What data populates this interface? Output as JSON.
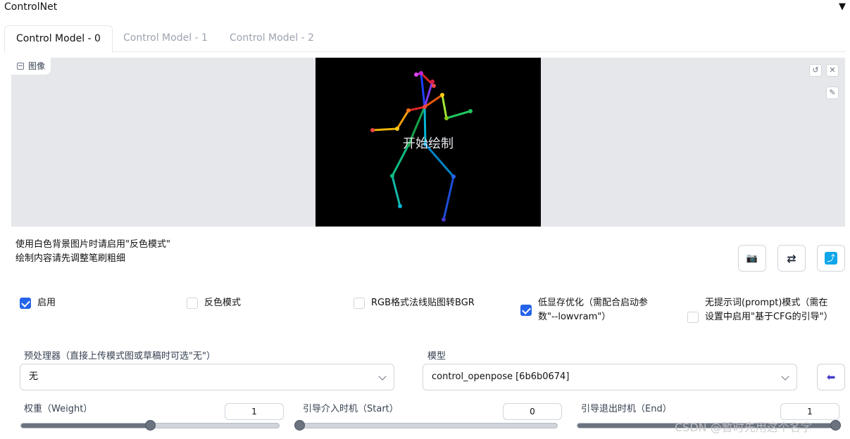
{
  "header": {
    "title": "ControlNet",
    "toggle_icon": "▼"
  },
  "tabs": [
    "Control Model - 0",
    "Control Model - 1",
    "Control Model - 2"
  ],
  "image_panel": {
    "label": "图像",
    "canvas_text": "开始绘制",
    "reset_icon": "↺",
    "close_icon": "✕",
    "brush_icon": "✎"
  },
  "hint": {
    "line1": "使用白色背景图片时请启用\"反色模式\"",
    "line2": "绘制内容请先调整笔刷粗细"
  },
  "actions": {
    "camera_icon": "📷",
    "swap_icon": "⇄",
    "send_icon": "⤴"
  },
  "checkboxes": {
    "enable": {
      "label": "启用",
      "checked": true
    },
    "invert": {
      "label": "反色模式",
      "checked": false
    },
    "rgb_bgr": {
      "label": "RGB格式法线贴图转BGR",
      "checked": false
    },
    "lowvram": {
      "label": "低显存优化（需配合启动参数\"--lowvram\"）",
      "checked": true
    },
    "guess_mode": {
      "label": "无提示词(prompt)模式（需在设置中启用\"基于CFG的引导\"）",
      "checked": false
    }
  },
  "preprocessor": {
    "label": "预处理器（直接上传模式图或草稿时可选\"无\"）",
    "value": "无"
  },
  "model": {
    "label": "模型",
    "value": "control_openpose [6b6b0674]",
    "refresh_icon": "⬅"
  },
  "sliders": {
    "weight": {
      "label": "权重（Weight）",
      "value": "1",
      "fraction": 0.5
    },
    "start": {
      "label": "引导介入时机（Start）",
      "value": "0",
      "fraction": 0.0
    },
    "end": {
      "label": "引导退出时机（End）",
      "value": "1",
      "fraction": 1.0
    }
  },
  "watermark": "CSDN @暂时先用这个名字"
}
